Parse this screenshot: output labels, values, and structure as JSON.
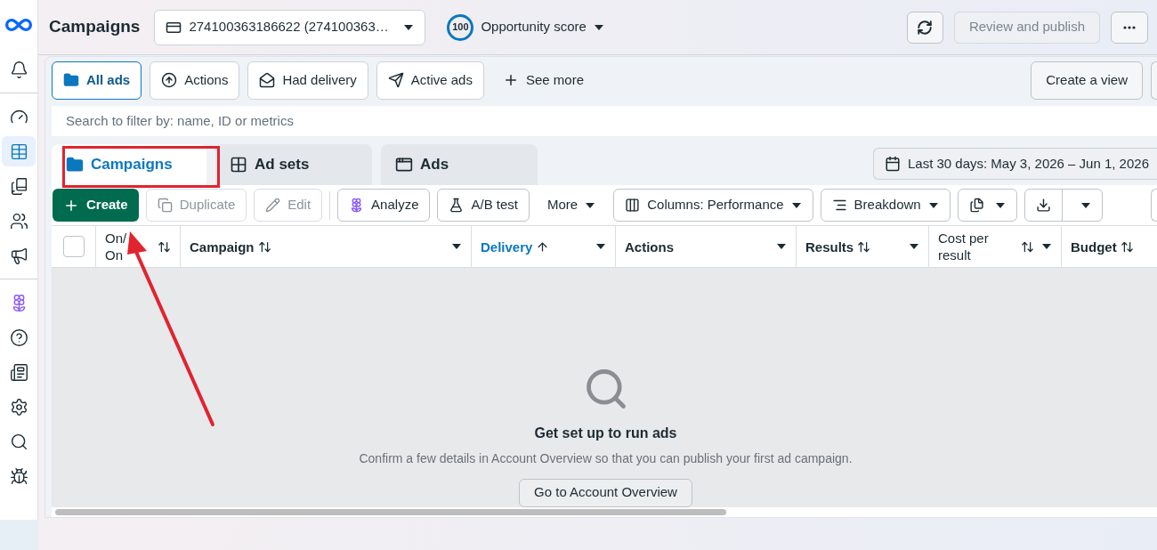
{
  "sidebar": {
    "items": [
      {
        "selected": false
      },
      {
        "selected": false
      },
      {
        "selected": true
      },
      {
        "selected": false
      },
      {
        "selected": false
      },
      {
        "selected": false
      },
      {
        "selected": false
      },
      {
        "selected": false
      },
      {
        "selected": false
      },
      {
        "selected": false
      },
      {
        "selected": false
      },
      {
        "selected": false
      }
    ]
  },
  "header": {
    "title": "Campaigns",
    "account": "274100363186622 (274100363…",
    "score": "100",
    "score_label": "Opportunity score",
    "buttons": [
      {
        "kind": "icon",
        "disabled": false
      },
      {
        "kind": "text",
        "label": "Review and publish",
        "disabled": true
      },
      {
        "kind": "more",
        "disabled": false
      }
    ]
  },
  "filters": [
    {
      "label": "All ads",
      "selected": true
    },
    {
      "label": "Actions",
      "selected": false
    },
    {
      "label": "Had delivery",
      "selected": false
    },
    {
      "label": "Active ads",
      "selected": false
    }
  ],
  "see_more": "See more",
  "create_view": "Create a view",
  "search": {
    "placeholder": "Search to filter by: name, ID or metrics"
  },
  "tabs": [
    {
      "label": "Campaigns",
      "selected": true
    },
    {
      "label": "Ad sets",
      "selected": false
    },
    {
      "label": "Ads",
      "selected": false
    }
  ],
  "date_range": "Last 30 days: May 3, 2026 – Jun 1, 2026",
  "toolbar": [
    {
      "kind": "primary",
      "label": "Create",
      "disabled": false
    },
    {
      "kind": "button",
      "label": "Duplicate",
      "disabled": true
    },
    {
      "kind": "button",
      "label": "Edit",
      "disabled": true
    },
    {
      "kind": "button",
      "label": "Analyze",
      "disabled": false
    },
    {
      "kind": "button",
      "label": "A/B test",
      "disabled": false
    },
    {
      "kind": "menu",
      "label": "More",
      "disabled": false
    },
    {
      "kind": "dropdown",
      "label": "Columns: Performance",
      "disabled": false
    },
    {
      "kind": "dropdown",
      "label": "Breakdown",
      "disabled": false
    },
    {
      "kind": "icon-dropdown",
      "disabled": false
    },
    {
      "kind": "split",
      "disabled": false
    }
  ],
  "table": {
    "select_all": {
      "checked": false
    },
    "columns": [
      {
        "label": "On/ On",
        "sortable": true,
        "sorted": false,
        "menu": false
      },
      {
        "label": "Campaign",
        "sortable": true,
        "sorted": false,
        "menu": true
      },
      {
        "label": "Delivery",
        "sortable": true,
        "sorted": true,
        "menu": true
      },
      {
        "label": "Actions",
        "sortable": false,
        "sorted": false,
        "menu": true
      },
      {
        "label": "Results",
        "sortable": true,
        "sorted": false,
        "menu": true
      },
      {
        "label": "Cost per result",
        "sortable": true,
        "sorted": false,
        "menu": true
      },
      {
        "label": "Budget",
        "sortable": true,
        "sorted": false,
        "menu": false
      }
    ]
  },
  "empty_state": {
    "title": "Get set up to run ads",
    "text": "Confirm a few details in Account Overview so that you can publish your first ad campaign.",
    "button": "Go to Account Overview"
  }
}
